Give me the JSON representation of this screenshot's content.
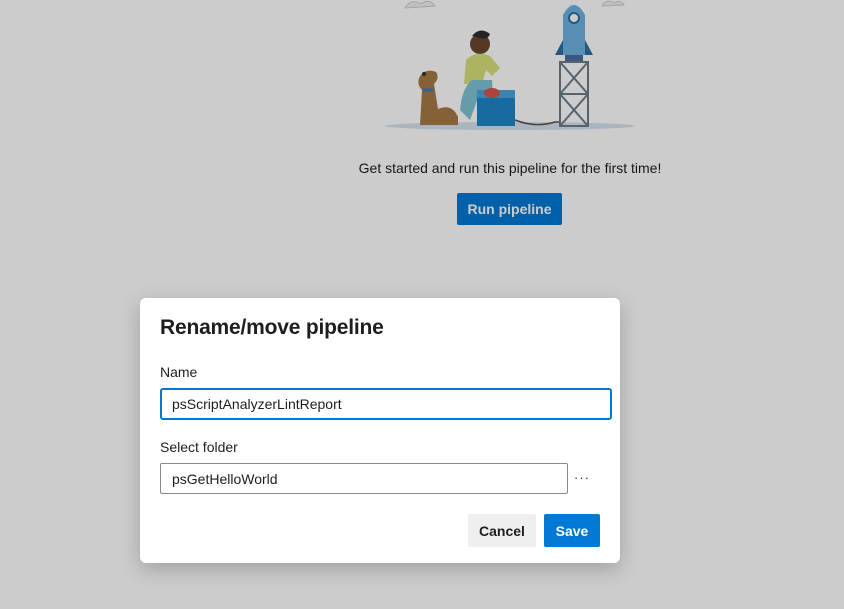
{
  "empty_state": {
    "message": "Get started and run this pipeline for the first time!",
    "run_button_label": "Run pipeline"
  },
  "dialog": {
    "title": "Rename/move pipeline",
    "name_label": "Name",
    "name_value": "psScriptAnalyzerLintReport",
    "folder_label": "Select folder",
    "folder_value": "psGetHelloWorld",
    "more_button_label": "···",
    "cancel_label": "Cancel",
    "save_label": "Save"
  },
  "colors": {
    "accent": "#0078d4",
    "overlay": "rgba(0,0,0,0.2)",
    "spellcheck": "#e81123"
  }
}
